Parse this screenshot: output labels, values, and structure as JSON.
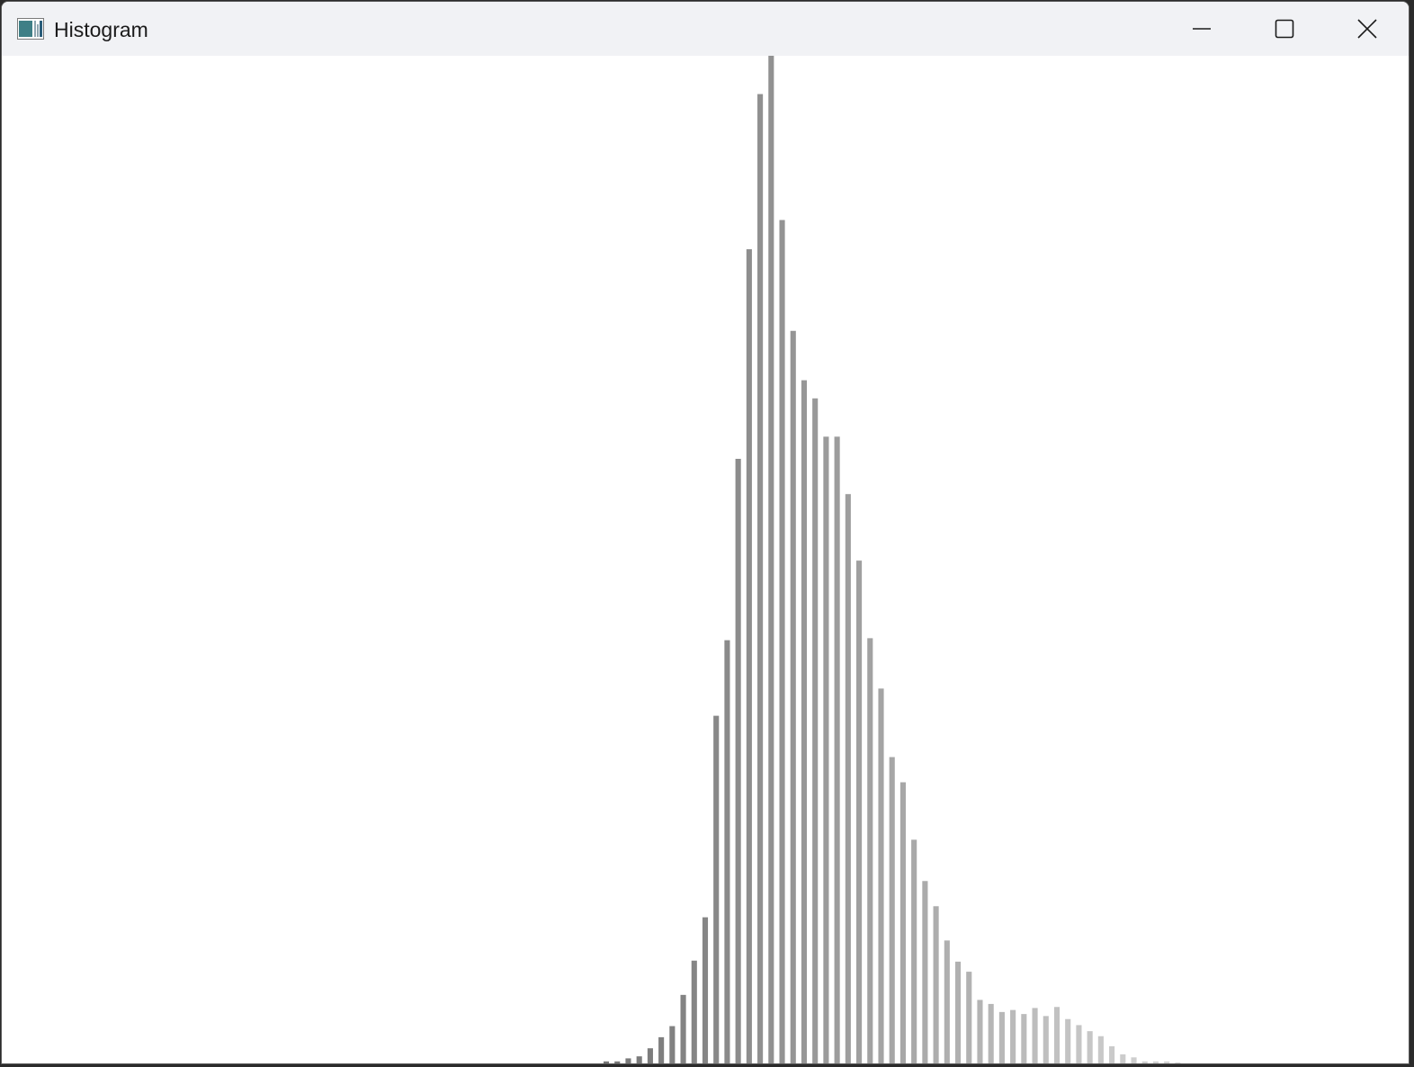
{
  "window": {
    "title": "Histogram",
    "icon": "histogram-app-icon",
    "controls": {
      "minimize_icon": "minimize-icon",
      "maximize_icon": "maximize-icon",
      "close_icon": "close-icon"
    }
  },
  "chart_data": {
    "type": "bar",
    "x_range": [
      0,
      255
    ],
    "bin_width": 2,
    "ylim": [
      0,
      1
    ],
    "grid": false,
    "bar_color": "gray, shade by intensity",
    "x": [
      110,
      112,
      114,
      116,
      118,
      120,
      122,
      124,
      126,
      128,
      130,
      132,
      134,
      136,
      138,
      140,
      142,
      144,
      146,
      148,
      150,
      152,
      154,
      156,
      158,
      160,
      162,
      164,
      166,
      168,
      170,
      172,
      174,
      176,
      178,
      180,
      182,
      184,
      186,
      188,
      190,
      192,
      194,
      196,
      198,
      200,
      202,
      204,
      206,
      208,
      210,
      212,
      214
    ],
    "values": [
      0.002,
      0.002,
      0.005,
      0.007,
      0.015,
      0.026,
      0.037,
      0.068,
      0.102,
      0.145,
      0.345,
      0.42,
      0.6,
      0.808,
      0.962,
      1.0,
      0.837,
      0.727,
      0.678,
      0.66,
      0.622,
      0.622,
      0.565,
      0.499,
      0.422,
      0.372,
      0.304,
      0.279,
      0.222,
      0.181,
      0.156,
      0.122,
      0.101,
      0.091,
      0.063,
      0.059,
      0.051,
      0.053,
      0.049,
      0.055,
      0.047,
      0.056,
      0.044,
      0.038,
      0.032,
      0.027,
      0.017,
      0.009,
      0.006,
      0.002,
      0.002,
      0.002,
      0.001
    ]
  }
}
